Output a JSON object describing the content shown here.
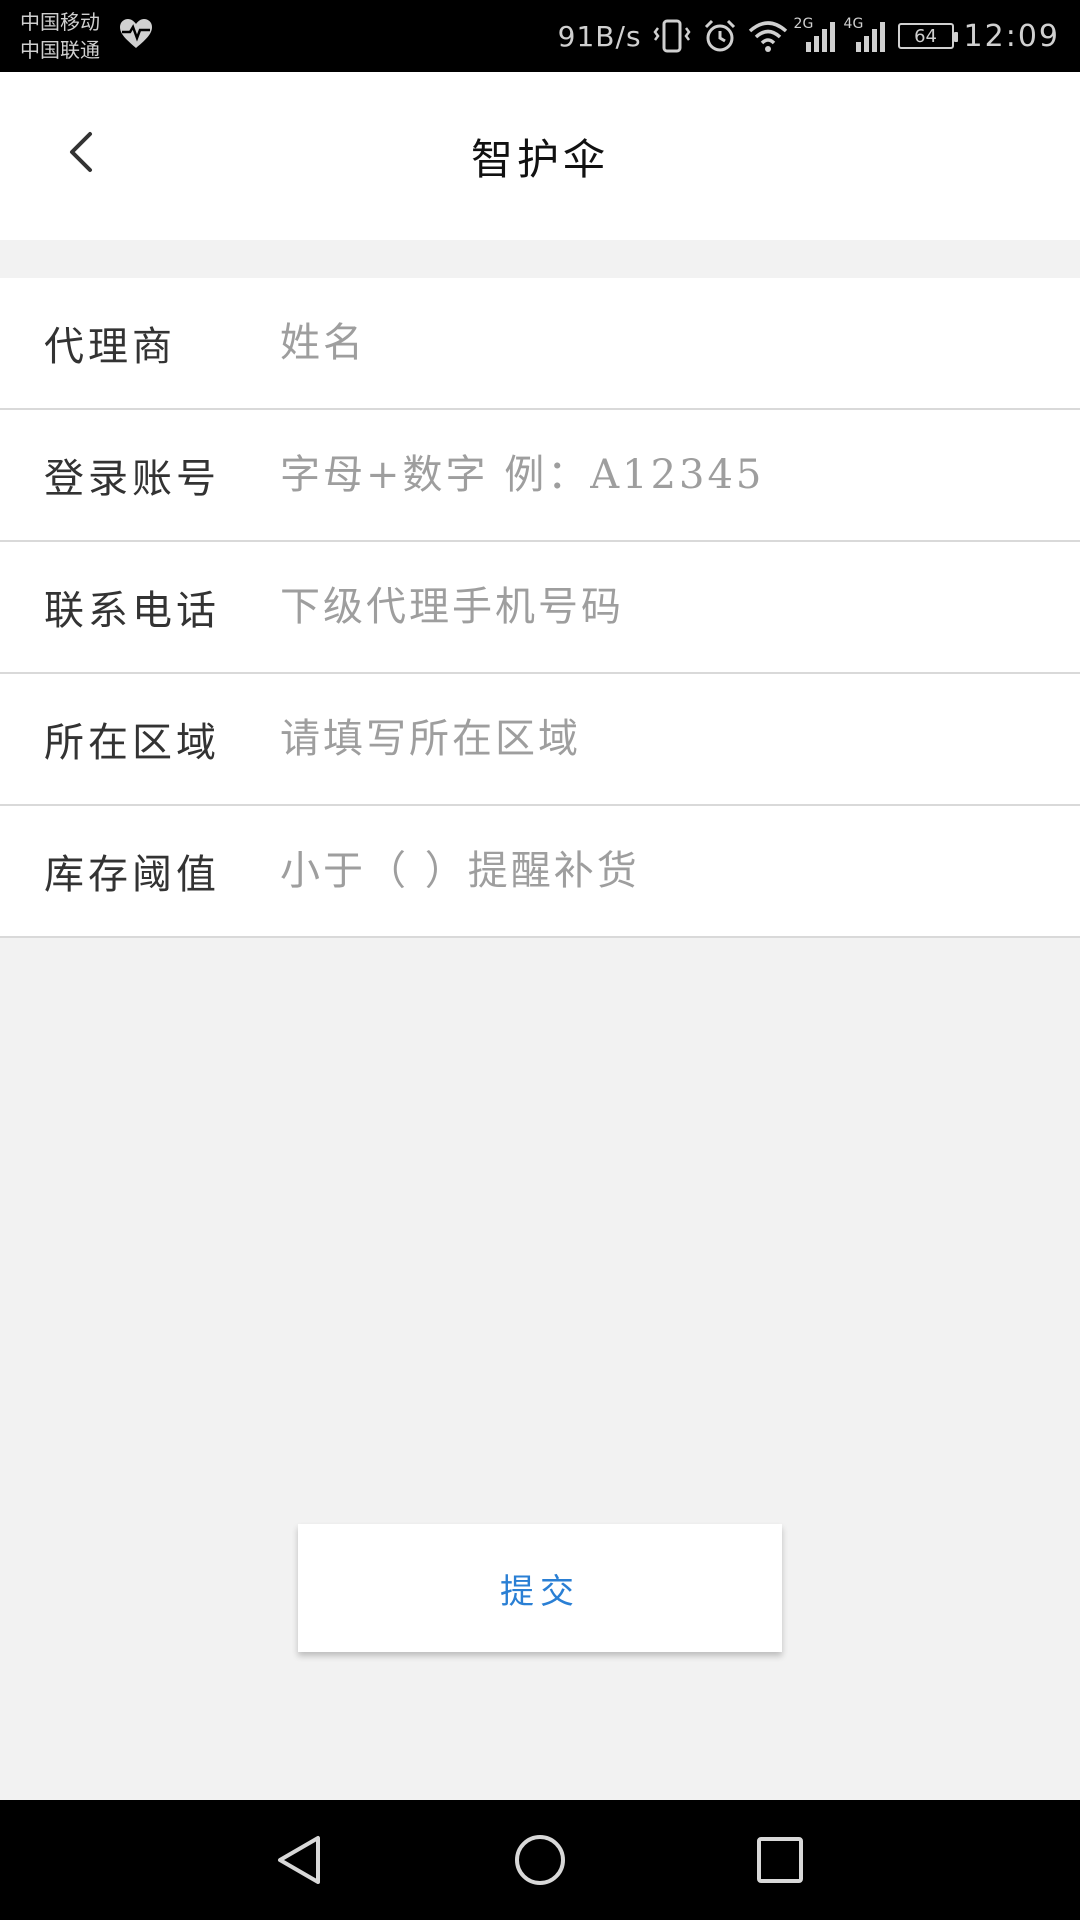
{
  "status_bar": {
    "carrier_1": "中国移动",
    "carrier_2": "中国联通",
    "net_speed": "91B/s",
    "signal_1_label": "2G",
    "signal_2_label": "4G",
    "battery": "64",
    "time": "12:09",
    "icons": [
      "heart-monitor-icon",
      "vibrate-icon",
      "alarm-icon",
      "wifi-icon",
      "signal-icon",
      "battery-icon"
    ]
  },
  "header": {
    "title": "智护伞",
    "back_icon": "chevron-left-icon"
  },
  "form": {
    "rows": [
      {
        "label": "代理商",
        "placeholder": "姓名"
      },
      {
        "label": "登录账号",
        "placeholder": "字母+数字 例：A12345"
      },
      {
        "label": "联系电话",
        "placeholder": "下级代理手机号码"
      },
      {
        "label": "所在区域",
        "placeholder": "请填写所在区域"
      },
      {
        "label": "库存阈值",
        "placeholder": "小于（ ）提醒补货"
      }
    ]
  },
  "submit": {
    "label": "提交",
    "color": "#2a7fd4"
  },
  "nav_bar": {
    "icons": [
      "back-triangle-icon",
      "home-circle-icon",
      "recents-square-icon"
    ]
  }
}
